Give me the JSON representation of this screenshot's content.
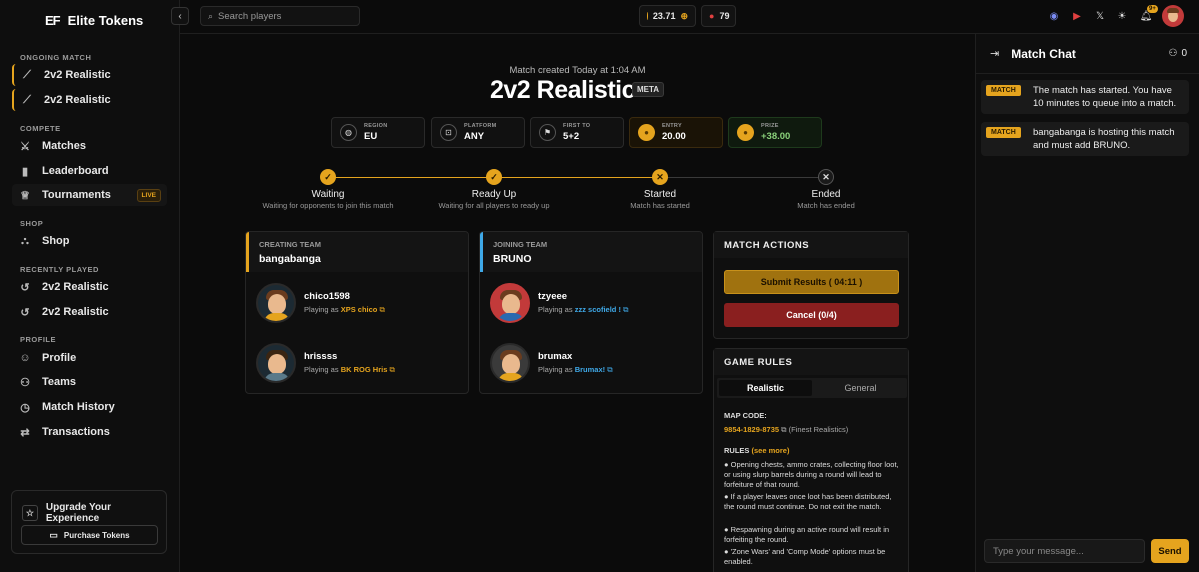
{
  "brand": {
    "logo": "EF",
    "name": "Elite Tokens"
  },
  "sidebar": {
    "ongoing_label": "ONGOING MATCH",
    "ongoing": [
      "2v2 Realistic",
      "2v2 Realistic"
    ],
    "compete_label": "COMPETE",
    "compete": [
      {
        "label": "Matches"
      },
      {
        "label": "Leaderboard"
      },
      {
        "label": "Tournaments",
        "badge": "LIVE"
      }
    ],
    "shop_label": "SHOP",
    "shop": "Shop",
    "recent_label": "RECENTLY PLAYED",
    "recent": [
      "2v2 Realistic",
      "2v2 Realistic"
    ],
    "profile_label": "PROFILE",
    "profile": [
      "Profile",
      "Teams",
      "Match History",
      "Transactions"
    ],
    "upgrade_title": "Upgrade Your Experience",
    "upgrade_button": "Purchase Tokens"
  },
  "topbar": {
    "search_placeholder": "Search players",
    "balance": "23.71",
    "points": "79",
    "notif_badge": "9+"
  },
  "match": {
    "created": "Match created Today at 1:04 AM",
    "title": "2v2 Realistic",
    "tag": "META",
    "info": [
      {
        "label": "REGION",
        "value": "EU"
      },
      {
        "label": "PLATFORM",
        "value": "ANY"
      },
      {
        "label": "FIRST TO",
        "value": "5+2"
      },
      {
        "label": "ENTRY",
        "value": "20.00"
      },
      {
        "label": "PRIZE",
        "value": "+38.00"
      }
    ],
    "steps": [
      {
        "title": "Waiting",
        "sub": "Waiting for opponents to join this match"
      },
      {
        "title": "Ready Up",
        "sub": "Waiting for all players to ready up"
      },
      {
        "title": "Started",
        "sub": "Match has started"
      },
      {
        "title": "Ended",
        "sub": "Match has ended"
      }
    ]
  },
  "teams": [
    {
      "label": "CREATING TEAM",
      "name": "bangabanga",
      "players": [
        {
          "name": "chico1598",
          "playing_as": "Playing as",
          "ign": "XPS chico"
        },
        {
          "name": "hrissss",
          "playing_as": "Playing as",
          "ign": "BK ROG Hris"
        }
      ]
    },
    {
      "label": "JOINING TEAM",
      "name": "BRUNO",
      "players": [
        {
          "name": "tzyeee",
          "playing_as": "Playing as",
          "ign": "zzz scofield !"
        },
        {
          "name": "brumax",
          "playing_as": "Playing as",
          "ign": "Brumax!"
        }
      ]
    }
  ],
  "actions": {
    "title": "MATCH ACTIONS",
    "submit": "Submit Results (  04:11  )",
    "cancel": "Cancel (0/4)"
  },
  "rules": {
    "title": "GAME RULES",
    "tabs": [
      "Realistic",
      "General"
    ],
    "map_label": "MAP CODE:",
    "map_code": "9854-1829-8735",
    "map_note": "(Finest Realistics)",
    "rules_label": "RULES",
    "see_more": "(see more)",
    "items": [
      "● Opening chests, ammo crates, collecting floor loot, or using slurp barrels during a round will lead to forfeiture of that round.",
      "● If a player leaves once loot has been distributed, the round must continue. Do not exit the match.",
      "● Respawning during an active round will result in forfeiting the round.",
      "● 'Zone Wars' and 'Comp Mode' options must be enabled."
    ]
  },
  "chat": {
    "title": "Match Chat",
    "count": "0",
    "messages": [
      {
        "tag": "MATCH",
        "text": "The match has started. You have 10 minutes to queue into a match."
      },
      {
        "tag": "MATCH",
        "text": "bangabanga is hosting this match and must add BRUNO."
      }
    ],
    "placeholder": "Type your message...",
    "send": "Send"
  }
}
